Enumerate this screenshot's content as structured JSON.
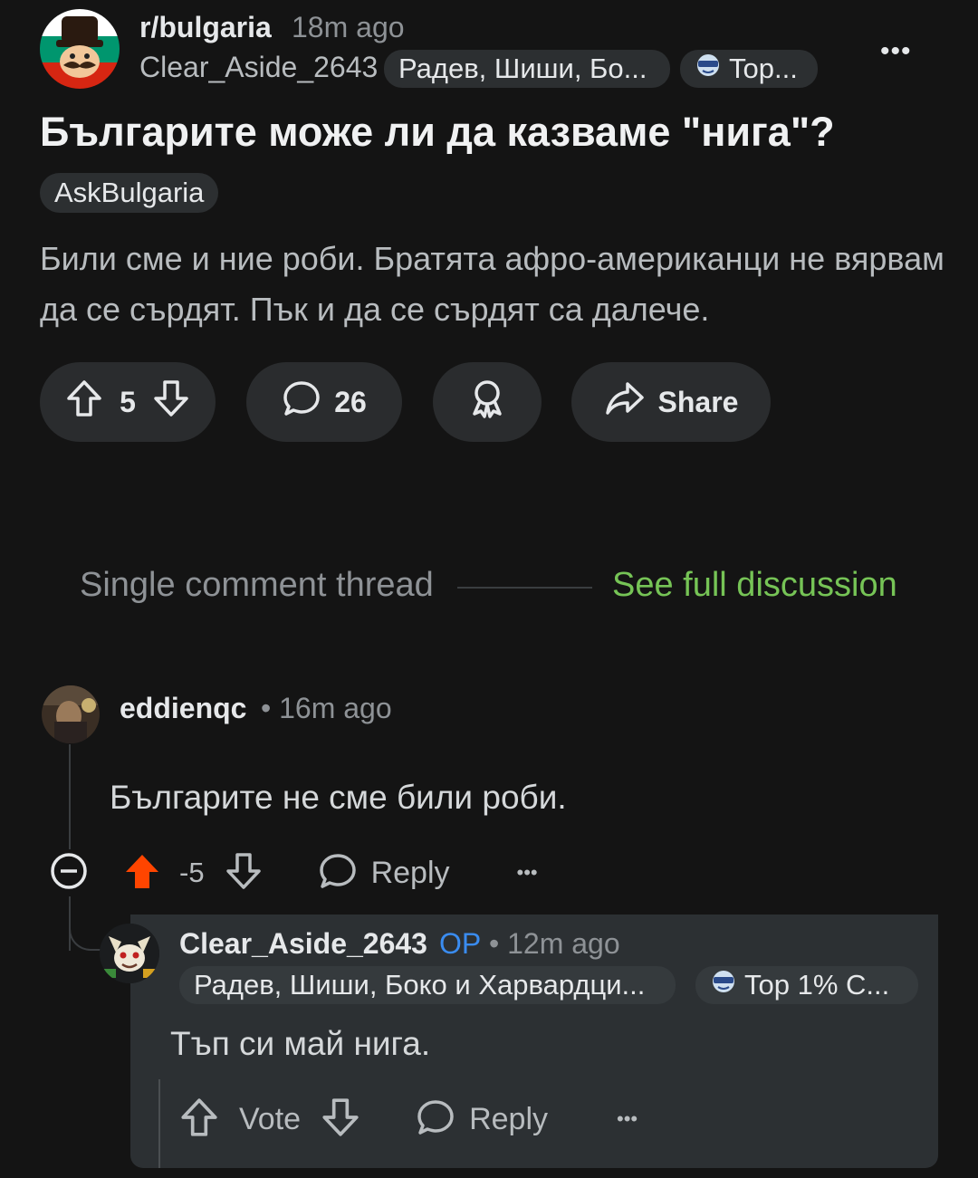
{
  "post": {
    "subreddit": "r/bulgaria",
    "time": "18m ago",
    "author": "Clear_Aside_2643",
    "flair_text": "Радев, Шиши, Бо...",
    "flair_badge": "Top...",
    "more": "•••",
    "title": "Българите може ли да казваме \"нига\"?",
    "tag": "AskBulgaria",
    "body": "Били сме и ние роби. Братята афро-американци не вярвам да се сърдят. Пък и да се сърдят са далече.",
    "score": "5",
    "comments": "26",
    "share_label": "Share"
  },
  "thread": {
    "label": "Single comment thread",
    "link": "See full discussion"
  },
  "comment1": {
    "author": "eddienqc",
    "time": "• 16m ago",
    "body": "Българите не сме били роби.",
    "score": "-5",
    "reply_label": "Reply",
    "more": "•••"
  },
  "comment2": {
    "author": "Clear_Aside_2643",
    "op": "OP",
    "time": "• 12m ago",
    "flair_text": "Радев, Шиши, Боко и Харвардци...",
    "flair_badge": "Top 1% C...",
    "body": "Тъп си май нига.",
    "vote_label": "Vote",
    "reply_label": "Reply",
    "more": "•••"
  },
  "colors": {
    "background": "#141414",
    "link_green": "#76c456",
    "op_blue": "#3a8cf0",
    "upvote_orange": "#ff4500",
    "highlight": "#2c3033"
  }
}
